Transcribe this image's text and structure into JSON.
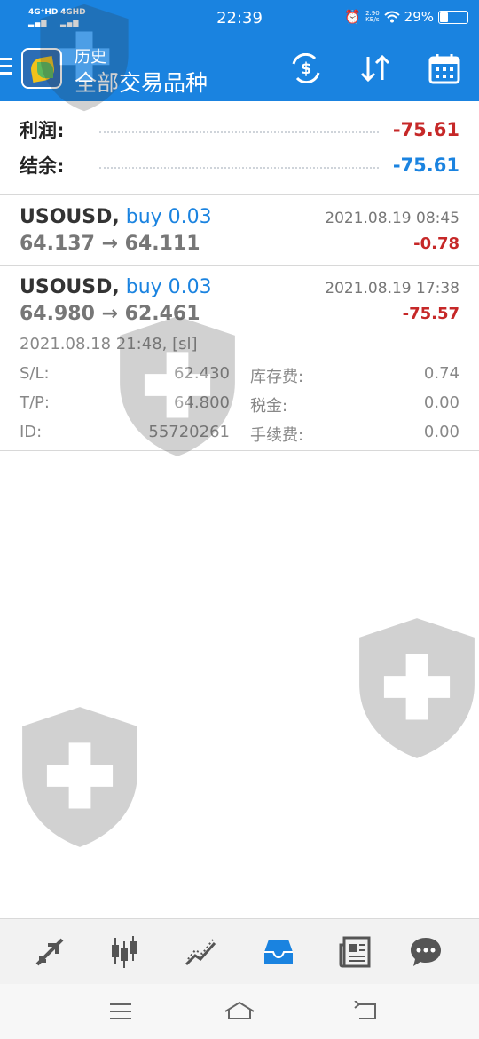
{
  "status_bar": {
    "network1": "4G⁺HD",
    "network2": "4GHD",
    "time": "22:39",
    "speed_value": "2.90",
    "speed_unit": "KB/s",
    "battery": "29%",
    "battery_level": 0.29
  },
  "header": {
    "title": "历史",
    "subtitle": "全部交易品种"
  },
  "summary": {
    "profit_label": "利润:",
    "profit_value": "-75.61",
    "balance_label": "结余:",
    "balance_value": "-75.61"
  },
  "trades": [
    {
      "symbol": "USOUSD,",
      "side": "buy 0.03",
      "date": "2021.08.19 08:45",
      "prices": "64.137 → 64.111",
      "profit": "-0.78"
    },
    {
      "symbol": "USOUSD,",
      "side": "buy 0.03",
      "date": "2021.08.19 17:38",
      "prices": "64.980 → 62.461",
      "profit": "-75.57",
      "open_info": "2021.08.18 21:48, [sl]",
      "sl_label": "S/L:",
      "sl_value": "62.430",
      "tp_label": "T/P:",
      "tp_value": "64.800",
      "id_label": "ID:",
      "id_value": "55720261",
      "swap_label": "库存费:",
      "swap_value": "0.74",
      "tax_label": "税金:",
      "tax_value": "0.00",
      "commission_label": "手续费:",
      "commission_value": "0.00"
    }
  ],
  "colors": {
    "primary": "#1a83e0",
    "negative": "#c62828",
    "positive_blue": "#1a83e0"
  },
  "icons": {
    "header": [
      "currency-exchange-icon",
      "sort-icon",
      "calendar-icon"
    ],
    "bottom_nav": [
      "trade-arrows-icon",
      "candlestick-chart-icon",
      "line-chart-icon",
      "history-inbox-icon",
      "news-icon",
      "chat-icon"
    ],
    "system_nav": [
      "menu-lines-icon",
      "home-icon",
      "back-icon"
    ]
  }
}
